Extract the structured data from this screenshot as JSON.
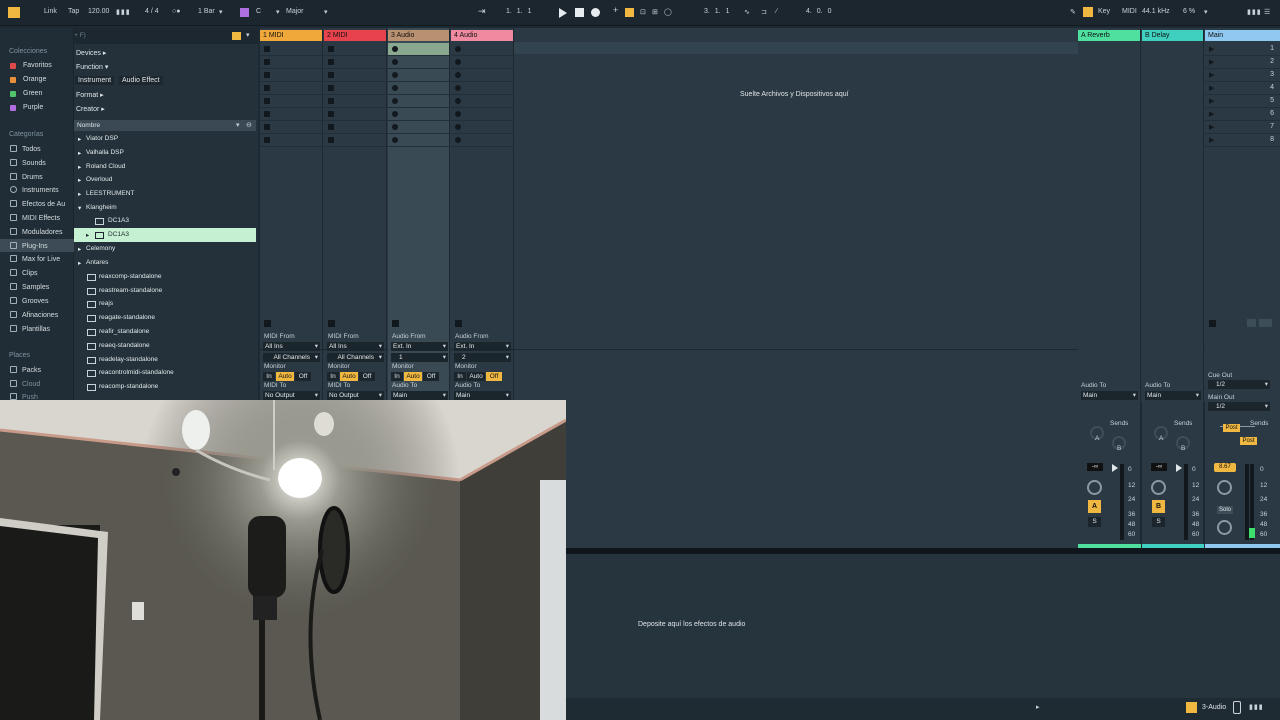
{
  "transport": {
    "link": "Link",
    "tap": "Tap",
    "tempo": "120.00",
    "time_signature": "4 / 4",
    "quantize": "1 Bar",
    "key": "C",
    "scale": "Major",
    "position": "1.  1.  1",
    "loop_start": "3.  1.  1",
    "loop_length": "4.  0.  0",
    "key_label": "Key",
    "midi_label": "MIDI",
    "sample_rate": "44.1 kHz",
    "cpu": "6 %"
  },
  "browser": {
    "search_placeholder": "Buscar (Ctrl + F)",
    "filters": {
      "devices": "Devices",
      "function": "Function",
      "tags": [
        "Instrument",
        "Audio Effect"
      ],
      "format": "Format",
      "creator": "Creator"
    },
    "name_header": "Nombre",
    "collections_header": "Colecciones",
    "collections": [
      {
        "label": "Favoritos",
        "color": "#e04a4a"
      },
      {
        "label": "Orange",
        "color": "#e8913a"
      },
      {
        "label": "Green",
        "color": "#4fc46a"
      },
      {
        "label": "Purple",
        "color": "#b26ee0"
      }
    ],
    "categories_header": "Categorías",
    "categories": [
      "Todos",
      "Sounds",
      "Drums",
      "Instruments",
      "Efectos de Au",
      "MIDI Effects",
      "Moduladores",
      "Plug-Ins",
      "Max for Live",
      "Clips",
      "Samples",
      "Grooves",
      "Afinaciones",
      "Plantillas"
    ],
    "places_header": "Places",
    "places": [
      "Packs",
      "Cloud",
      "Push"
    ],
    "items": [
      "Viator DSP",
      "Valhalla DSP",
      "Roland Cloud",
      "Overloud",
      "LEESTRUMENT",
      "Klangheim",
      "DC1A3",
      "DC1A3",
      "Celemony",
      "Antares",
      "reaxcomp-standalone",
      "reastream-standalone",
      "reajs",
      "reagate-standalone",
      "reafir_standalone",
      "reaeq-standalone",
      "readelay-standalone",
      "reacontrolmidi-standalone",
      "reacomp-standalone"
    ]
  },
  "tracks": [
    {
      "name": "1 MIDI",
      "color": "#f0a83a",
      "from_label": "MIDI From",
      "from": "All Ins",
      "channel": "All Channels",
      "monitor_label": "Monitor",
      "to_label": "MIDI To",
      "to": "No Output"
    },
    {
      "name": "2 MIDI",
      "color": "#e8434d",
      "from_label": "MIDI From",
      "from": "All Ins",
      "channel": "All Channels",
      "monitor_label": "Monitor",
      "to_label": "MIDI To",
      "to": "No Output"
    },
    {
      "name": "3 Audio",
      "color": "#b99070",
      "from_label": "Audio From",
      "from": "Ext. In",
      "channel": "1",
      "monitor_label": "Monitor",
      "to_label": "Audio To",
      "to": "Main"
    },
    {
      "name": "4 Audio",
      "color": "#f08aa0",
      "from_label": "Audio From",
      "from": "Ext. In",
      "channel": "2",
      "monitor_label": "Monitor",
      "to_label": "Audio To",
      "to": "Main"
    }
  ],
  "monitor_options": [
    "In",
    "Auto",
    "Off"
  ],
  "returns": [
    {
      "name": "A Reverb",
      "color": "#4fe0a0",
      "to_label": "Audio To",
      "to": "Main",
      "send_letter": "A",
      "volume": "-∞"
    },
    {
      "name": "B Delay",
      "color": "#3fd0c0",
      "to_label": "Audio To",
      "to": "Main",
      "send_letter": "B",
      "volume": "-∞"
    }
  ],
  "main": {
    "name": "Main",
    "color": "#8fc8f0",
    "scenes": [
      "1",
      "2",
      "3",
      "4",
      "5",
      "6",
      "7",
      "8"
    ],
    "cue_out_label": "Cue Out",
    "cue_out": "1/2",
    "main_out_label": "Main Out",
    "main_out": "1/2",
    "volume": "8.67",
    "solo": "Solo"
  },
  "sends_label": "Sends",
  "post_label": "Post",
  "meter_scale": [
    "0",
    "12",
    "24",
    "36",
    "48",
    "60"
  ],
  "drop_files_text": "Suelte Archivos y Dispositivos aquí",
  "drop_effects_text": "Deposite aquí los efectos de audio",
  "status_track": "3-Audio"
}
